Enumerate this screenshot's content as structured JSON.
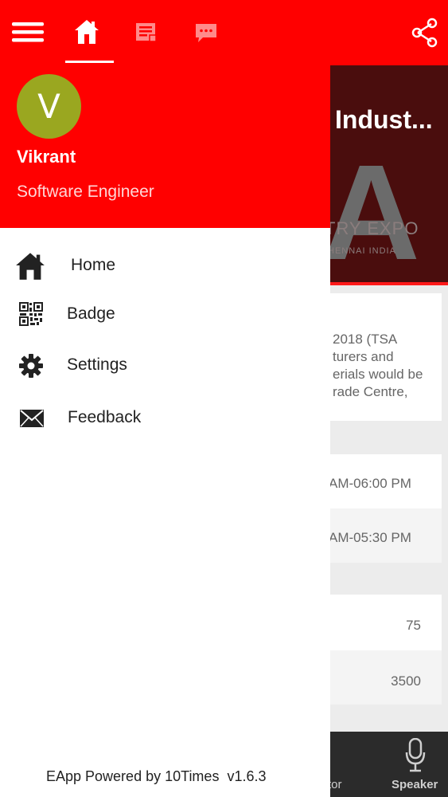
{
  "topbar": {
    "menu_icon": "hamburger-menu-icon",
    "tabs": [
      {
        "icon": "home-icon",
        "active": true
      },
      {
        "icon": "agenda-list-icon",
        "active": false
      },
      {
        "icon": "chat-bubble-icon",
        "active": false
      }
    ],
    "share_icon": "share-icon"
  },
  "background": {
    "banner_title": "Indust...",
    "banner_letter": "A",
    "banner_expo": "TRY EXPO",
    "banner_city": "HENNAI INDIA",
    "description_lines": [
      "2018 (TSA",
      "turers and",
      "erials would be",
      "rade Centre,"
    ],
    "timings": [
      "AM-06:00 PM",
      "AM-05:30 PM"
    ],
    "stats": [
      "75",
      "3500"
    ],
    "bottom_tabs": [
      "tor",
      "Speaker"
    ]
  },
  "user": {
    "initial": "V",
    "name": "Vikrant",
    "role": "Software Engineer",
    "avatar_color": "#9aa720"
  },
  "menu": [
    {
      "label": "Home",
      "icon": "home-icon"
    },
    {
      "label": "Badge",
      "icon": "qr-code-icon"
    },
    {
      "label": "Settings",
      "icon": "gear-icon"
    },
    {
      "label": "Feedback",
      "icon": "envelope-icon"
    }
  ],
  "footer": {
    "powered_by": "EApp Powered by 10Times",
    "version": "v1.6.3"
  },
  "colors": {
    "brand_red": "#ff0000",
    "bottom_nav": "#2b2b2b"
  }
}
